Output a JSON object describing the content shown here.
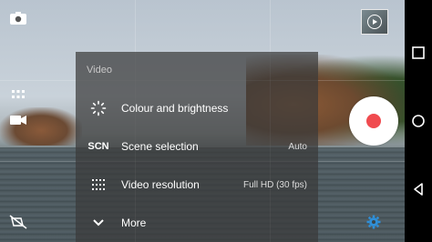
{
  "menu": {
    "title": "Video",
    "items": [
      {
        "icon": "brightness-icon",
        "label": "Colour and brightness",
        "value": ""
      },
      {
        "icon": "scn-icon",
        "label": "Scene selection",
        "value": "Auto",
        "icon_text": "SCN"
      },
      {
        "icon": "grid-dots-icon",
        "label": "Video resolution",
        "value": "Full HD (30 fps)"
      },
      {
        "icon": "chevron-down-icon",
        "label": "More",
        "value": ""
      }
    ]
  },
  "left_controls": [
    "switch-camera-icon",
    "mode-dots-icon",
    "video-mode-icon",
    "flash-off-icon"
  ],
  "thumbnail": {
    "icon": "play-icon"
  },
  "record": {
    "color": "#f04b4f"
  },
  "settings": {
    "icon": "gear-icon",
    "color": "#2f8fd8"
  },
  "navbar": [
    "back-icon",
    "home-icon",
    "recents-icon"
  ]
}
